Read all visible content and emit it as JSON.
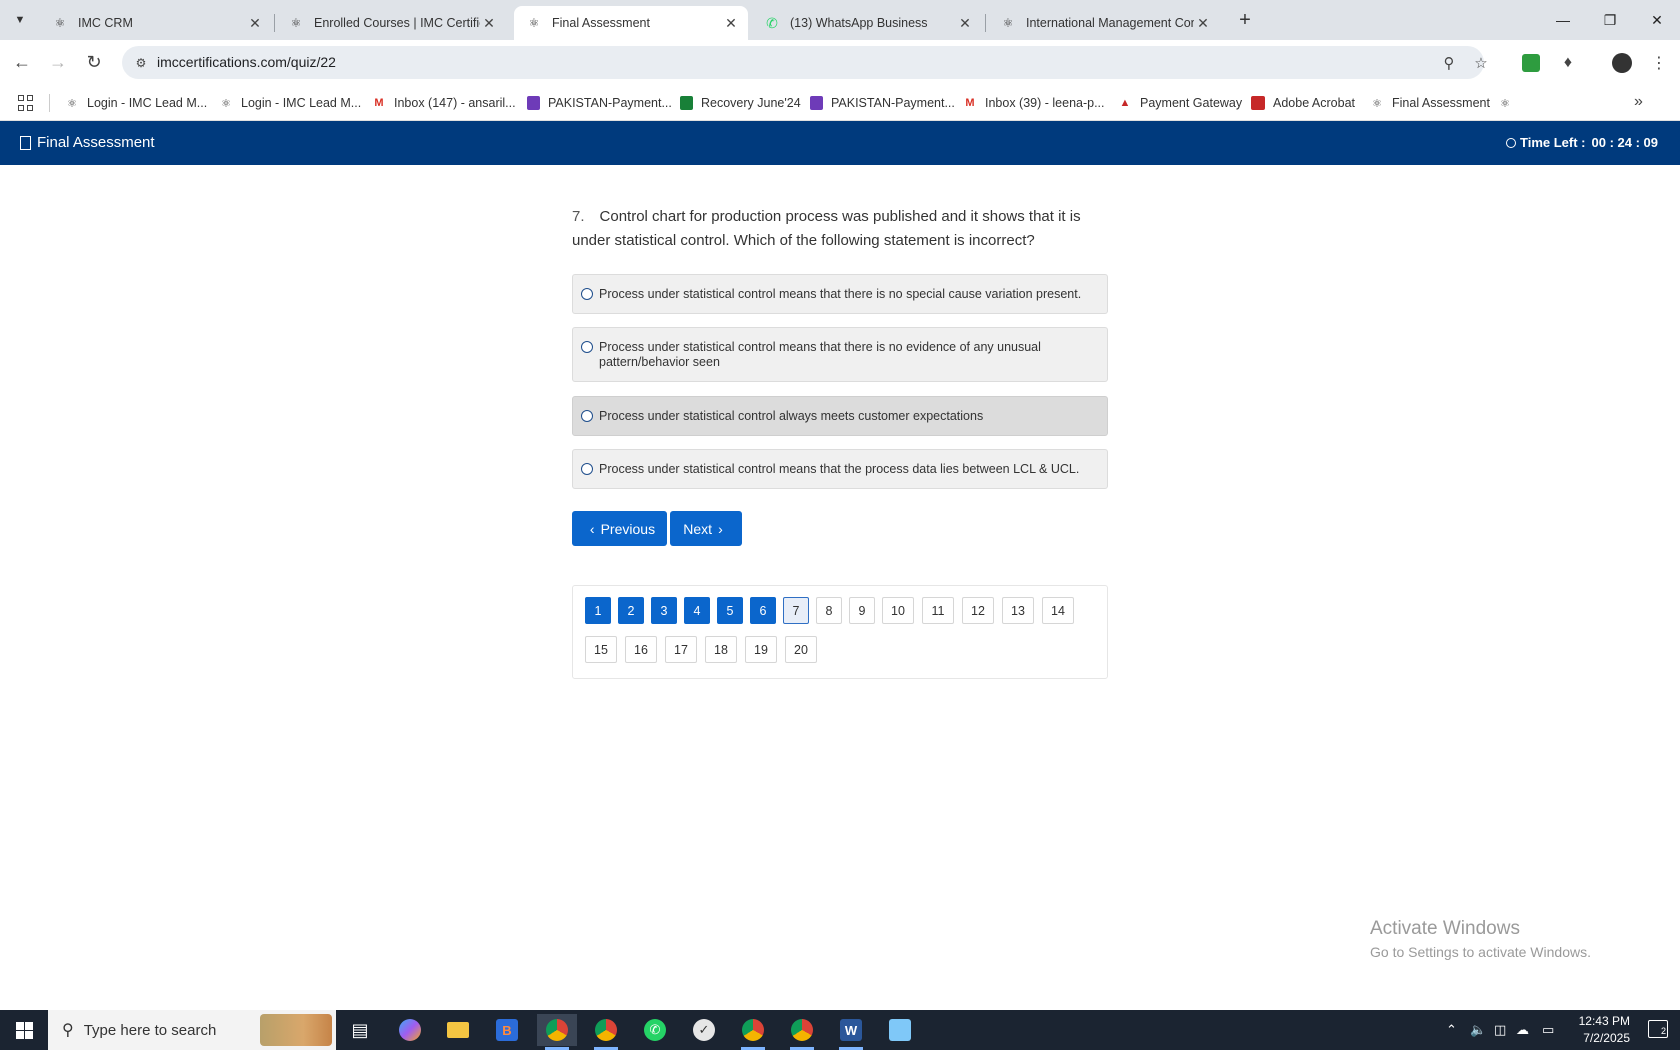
{
  "browser": {
    "tabs": [
      {
        "title": "IMC CRM",
        "icon": "imc-logo-icon",
        "active": false
      },
      {
        "title": "Enrolled Courses | IMC Certifica",
        "icon": "imc-logo-icon",
        "active": false
      },
      {
        "title": "Final Assessment",
        "icon": "imc-logo-icon",
        "active": true
      },
      {
        "title": "(13) WhatsApp Business",
        "icon": "whatsapp-icon",
        "active": false
      },
      {
        "title": "International Management Con",
        "icon": "imc-logo-icon",
        "active": false
      }
    ],
    "url": "imccertifications.com/quiz/22",
    "bookmarks": [
      {
        "label": "Login - IMC Lead M...",
        "icon": "imc-logo-icon"
      },
      {
        "label": "Login - IMC Lead M...",
        "icon": "imc-logo-icon"
      },
      {
        "label": "Inbox (147) - ansaril...",
        "icon": "gmail-icon"
      },
      {
        "label": "PAKISTAN-Payment...",
        "icon": "forms-icon"
      },
      {
        "label": "Recovery June'24",
        "icon": "sheets-icon"
      },
      {
        "label": "PAKISTAN-Payment...",
        "icon": "forms-icon"
      },
      {
        "label": "Inbox (39) - leena-p...",
        "icon": "gmail-icon"
      },
      {
        "label": "Payment Gateway",
        "icon": "payment-gateway-icon"
      },
      {
        "label": "Adobe Acrobat",
        "icon": "acrobat-icon"
      },
      {
        "label": "Final Assessment",
        "icon": "imc-logo-icon"
      }
    ]
  },
  "app": {
    "title": "Final Assessment",
    "timer_label": "Time Left :",
    "timer_value": "00 : 24 : 09"
  },
  "question": {
    "number": "7.",
    "text": "Control chart for production process was published and it shows that it is under statistical control. Which of the following statement is incorrect?",
    "options": [
      {
        "text": "Process under statistical control means that there is no special cause variation present.",
        "selected": false
      },
      {
        "text": "Process under statistical control means that there is no evidence of any unusual pattern/behavior seen",
        "selected": false
      },
      {
        "text": "Process under statistical control always meets customer expectations",
        "selected": true
      },
      {
        "text": "Process under statistical control means that the process data lies between LCL & UCL.",
        "selected": false
      }
    ]
  },
  "nav": {
    "previous": "Previous",
    "next": "Next"
  },
  "pagination": {
    "pages": [
      "1",
      "2",
      "3",
      "4",
      "5",
      "6",
      "7",
      "8",
      "9",
      "10",
      "11",
      "12",
      "13",
      "14",
      "15",
      "16",
      "17",
      "18",
      "19",
      "20"
    ],
    "answered": [
      "1",
      "2",
      "3",
      "4",
      "5",
      "6"
    ],
    "current": "7"
  },
  "watermark": {
    "line1": "Activate Windows",
    "line2": "Go to Settings to activate Windows."
  },
  "taskbar": {
    "search_placeholder": "Type here to search",
    "time": "12:43 PM",
    "date": "7/2/2025",
    "notifications": "2"
  },
  "colors": {
    "header": "#003a7d",
    "button": "#0b66cc",
    "answered": "#0b66cc"
  }
}
